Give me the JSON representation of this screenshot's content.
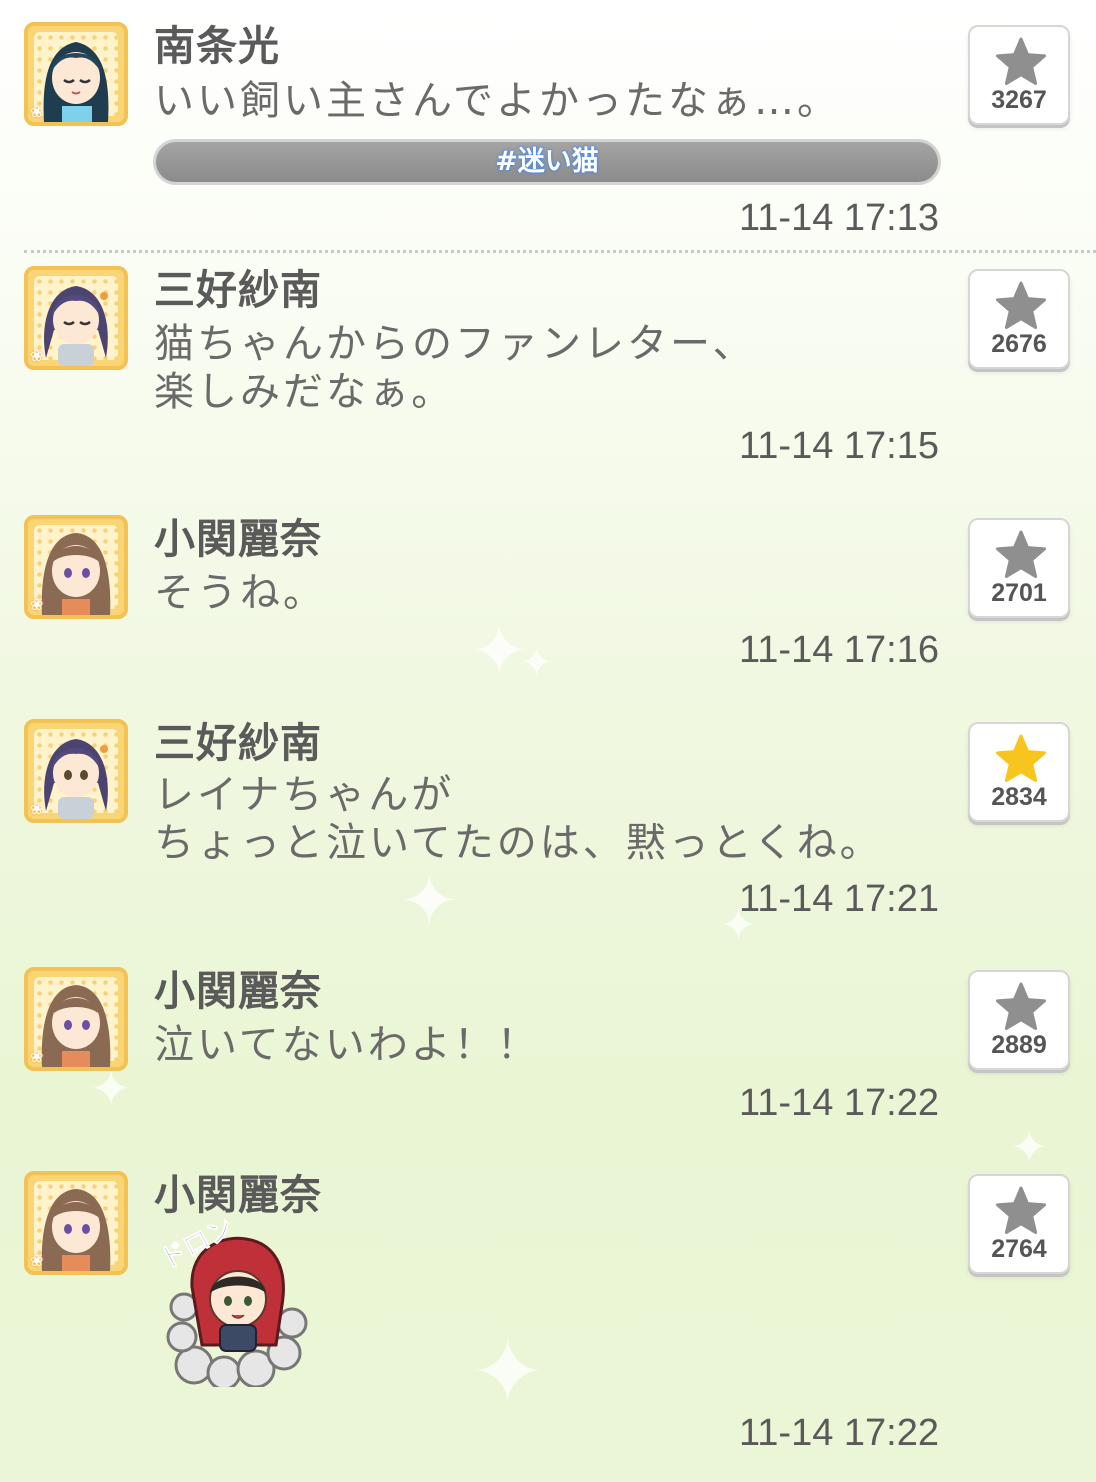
{
  "posts": [
    {
      "name": "南条光",
      "message": "いい飼い主さんでよかったなぁ…。",
      "hashtag": "#迷い猫",
      "timestamp": "11-14 17:13",
      "likes": "3267",
      "liked": false
    },
    {
      "name": "三好紗南",
      "message": "猫ちゃんからのファンレター、\n楽しみだなぁ。",
      "timestamp": "11-14 17:15",
      "likes": "2676",
      "liked": false
    },
    {
      "name": "小関麗奈",
      "message": "そうね。",
      "timestamp": "11-14 17:16",
      "likes": "2701",
      "liked": false
    },
    {
      "name": "三好紗南",
      "message": "レイナちゃんが\nちょっと泣いてたのは、黙っとくね。",
      "timestamp": "11-14 17:21",
      "likes": "2834",
      "liked": true
    },
    {
      "name": "小関麗奈",
      "message": "泣いてないわよ！！",
      "timestamp": "11-14 17:22",
      "likes": "2889",
      "liked": false
    },
    {
      "name": "小関麗奈",
      "sticker_text": "ドロン",
      "timestamp": "11-14 17:22",
      "likes": "2764",
      "liked": false
    }
  ],
  "colors": {
    "star_default": "#8f8f8f",
    "star_liked": "#f7c51e",
    "hashtag_glow": "#3d86ff",
    "avatar_frame": "#f3c255"
  },
  "icons": {
    "like": "star-icon",
    "avatar_badge": "flower-icon"
  }
}
